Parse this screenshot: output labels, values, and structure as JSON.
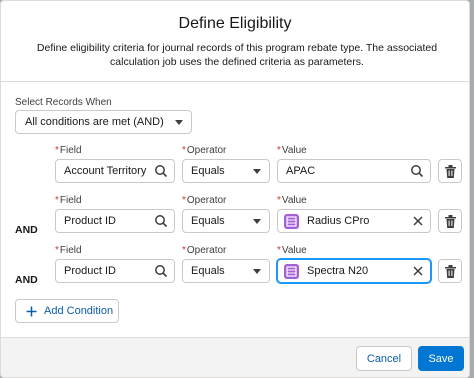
{
  "modal": {
    "title": "Define Eligibility",
    "description": "Define eligibility criteria for journal records of this program rebate type. The associated calculation job uses the defined criteria as parameters."
  },
  "select_records": {
    "label": "Select Records When",
    "value": "All conditions are met (AND)"
  },
  "labels": {
    "required_marker": "*",
    "field": "Field",
    "operator": "Operator",
    "value": "Value"
  },
  "conditions": [
    {
      "connector": "",
      "field": "Account Territory",
      "operator": "Equals",
      "value": "APAC",
      "value_type": "text"
    },
    {
      "connector": "AND",
      "field": "Product ID",
      "operator": "Equals",
      "value": "Radius CPro",
      "value_type": "record"
    },
    {
      "connector": "AND",
      "field": "Product ID",
      "operator": "Equals",
      "value": "Spectra N20",
      "value_type": "record"
    }
  ],
  "add_condition_label": "Add Condition",
  "footer": {
    "cancel_label": "Cancel",
    "save_label": "Save"
  },
  "colors": {
    "brand": "#0176d3",
    "record_icon": "#a35fd6",
    "required": "#c23934",
    "focus": "#1b96ff"
  },
  "icons": {
    "search": "search-icon",
    "dropdown": "chevron-down-icon",
    "delete": "trash-icon",
    "clear": "close-icon",
    "record": "product-record-icon",
    "add": "plus-icon"
  }
}
